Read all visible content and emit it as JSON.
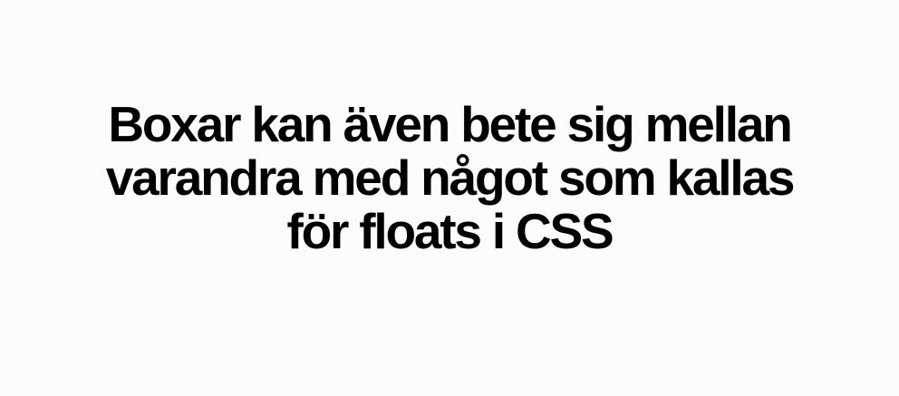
{
  "slide": {
    "headline_lines": [
      "Boxar kan även bete sig mellan",
      "varandra med något som kallas",
      "för floats i CSS"
    ]
  },
  "colors": {
    "background": "#fcfcfc",
    "text": "#000000"
  }
}
